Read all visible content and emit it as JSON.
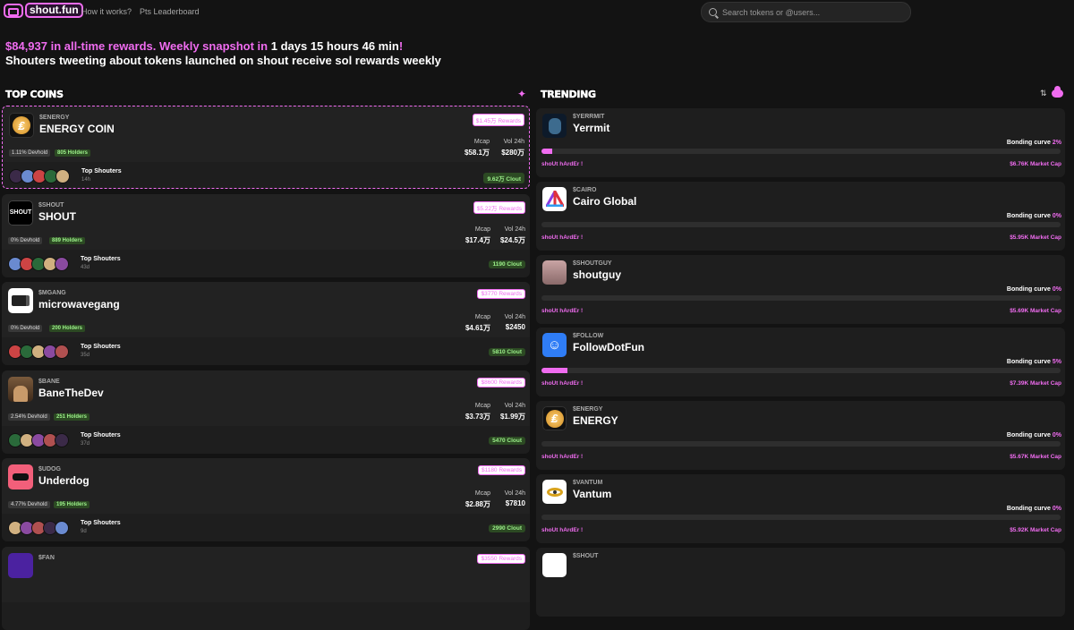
{
  "header": {
    "logo_text": "shout.fun",
    "nav": [
      "How it works?",
      "Pts Leaderboard"
    ],
    "search_placeholder": "Search tokens or @users..."
  },
  "banner": {
    "amount": "$84,937",
    "text1": " in all-time rewards. Weekly snapshot in ",
    "countdown": "1 days 15 hours 46 min",
    "text2": "!",
    "line2": "Shouters tweeting about tokens launched on shout receive sol rewards weekly"
  },
  "sections": {
    "top_coins": "TOP COINS",
    "trending": "TRENDING"
  },
  "colors": {
    "accent": "#f06cf0",
    "green": "#9cf08a",
    "bg": "#131313"
  },
  "top_coins": [
    {
      "ticker": "$ENERGY",
      "name": "ENERGY COIN",
      "rewards": "$1.45万 Rewards",
      "mcap_label": "Mcap",
      "mcap": "$58.1万",
      "vol_label": "Vol 24h",
      "vol": "$280万",
      "devhold": "1.11% Devhold",
      "holders": "805 Holders",
      "shouters_label": "Top Shouters",
      "time": "14h",
      "clout": "9.62万 Clout",
      "icon": "energy-icon"
    },
    {
      "ticker": "$SHOUT",
      "name": "SHOUT",
      "rewards": "$5.22万 Rewards",
      "mcap_label": "Mcap",
      "mcap": "$17.4万",
      "vol_label": "Vol 24h",
      "vol": "$24.5万",
      "devhold": "0% Devhold",
      "holders": "889 Holders",
      "shouters_label": "Top Shouters",
      "time": "43d",
      "clout": "1190 Clout",
      "icon_text": "SHOUT"
    },
    {
      "ticker": "$MGANG",
      "name": "microwavegang",
      "rewards": "$3770 Rewards",
      "mcap_label": "Mcap",
      "mcap": "$4.61万",
      "vol_label": "Vol 24h",
      "vol": "$2450",
      "devhold": "0% Devhold",
      "holders": "200 Holders",
      "shouters_label": "Top Shouters",
      "time": "35d",
      "clout": "5810 Clout",
      "icon": "microwave-icon"
    },
    {
      "ticker": "$BANE",
      "name": "BaneTheDev",
      "rewards": "$8600 Rewards",
      "mcap_label": "Mcap",
      "mcap": "$3.73万",
      "vol_label": "Vol 24h",
      "vol": "$1.99万",
      "devhold": "2.54% Devhold",
      "holders": "251 Holders",
      "shouters_label": "Top Shouters",
      "time": "37d",
      "clout": "5470 Clout",
      "icon": "bane-avatar-icon"
    },
    {
      "ticker": "$UDOG",
      "name": "Underdog",
      "rewards": "$1180 Rewards",
      "mcap_label": "Mcap",
      "mcap": "$2.88万",
      "vol_label": "Vol 24h",
      "vol": "$7810",
      "devhold": "4.77% Devhold",
      "holders": "195 Holders",
      "shouters_label": "Top Shouters",
      "time": "9d",
      "clout": "2990 Clout",
      "icon": "underdog-icon"
    },
    {
      "ticker": "$FAN",
      "name": "",
      "rewards": "$3550 Rewards",
      "icon": "fan-icon"
    }
  ],
  "trending": [
    {
      "ticker": "$YERRMIT",
      "name": "Yerrmit",
      "bonding_label": "Bonding curve",
      "bonding": "2%",
      "bonding_pct": 2,
      "cta": "shoUt hArdEr !",
      "mcap": "$6.76K Market Cap",
      "icon": "yerrmit-icon"
    },
    {
      "ticker": "$CAIRO",
      "name": "Cairo Global",
      "bonding_label": "Bonding curve",
      "bonding": "0%",
      "bonding_pct": 0,
      "cta": "shoUt hArdEr !",
      "mcap": "$5.95K Market Cap",
      "icon": "cairo-triangle-icon"
    },
    {
      "ticker": "$SHOUTGUY",
      "name": "shoutguy",
      "bonding_label": "Bonding curve",
      "bonding": "0%",
      "bonding_pct": 0,
      "cta": "shoUt hArdEr !",
      "mcap": "$5.69K Market Cap",
      "icon": "shoutguy-icon"
    },
    {
      "ticker": "$FOLLOW",
      "name": "FollowDotFun",
      "bonding_label": "Bonding curve",
      "bonding": "5%",
      "bonding_pct": 5,
      "cta": "shoUt hArdEr !",
      "mcap": "$7.39K Market Cap",
      "icon": "follow-icon"
    },
    {
      "ticker": "$ENERGY",
      "name": "ENERGY",
      "bonding_label": "Bonding curve",
      "bonding": "0%",
      "bonding_pct": 0,
      "cta": "shoUt hArdEr !",
      "mcap": "$5.67K Market Cap",
      "icon": "energy-icon"
    },
    {
      "ticker": "$VANTUM",
      "name": "Vantum",
      "bonding_label": "Bonding curve",
      "bonding": "0%",
      "bonding_pct": 0,
      "cta": "shoUt hArdEr !",
      "mcap": "$5.92K Market Cap",
      "icon": "vantum-eye-icon"
    },
    {
      "ticker": "$SHOUT",
      "name": "",
      "icon": "shout-icon"
    }
  ]
}
